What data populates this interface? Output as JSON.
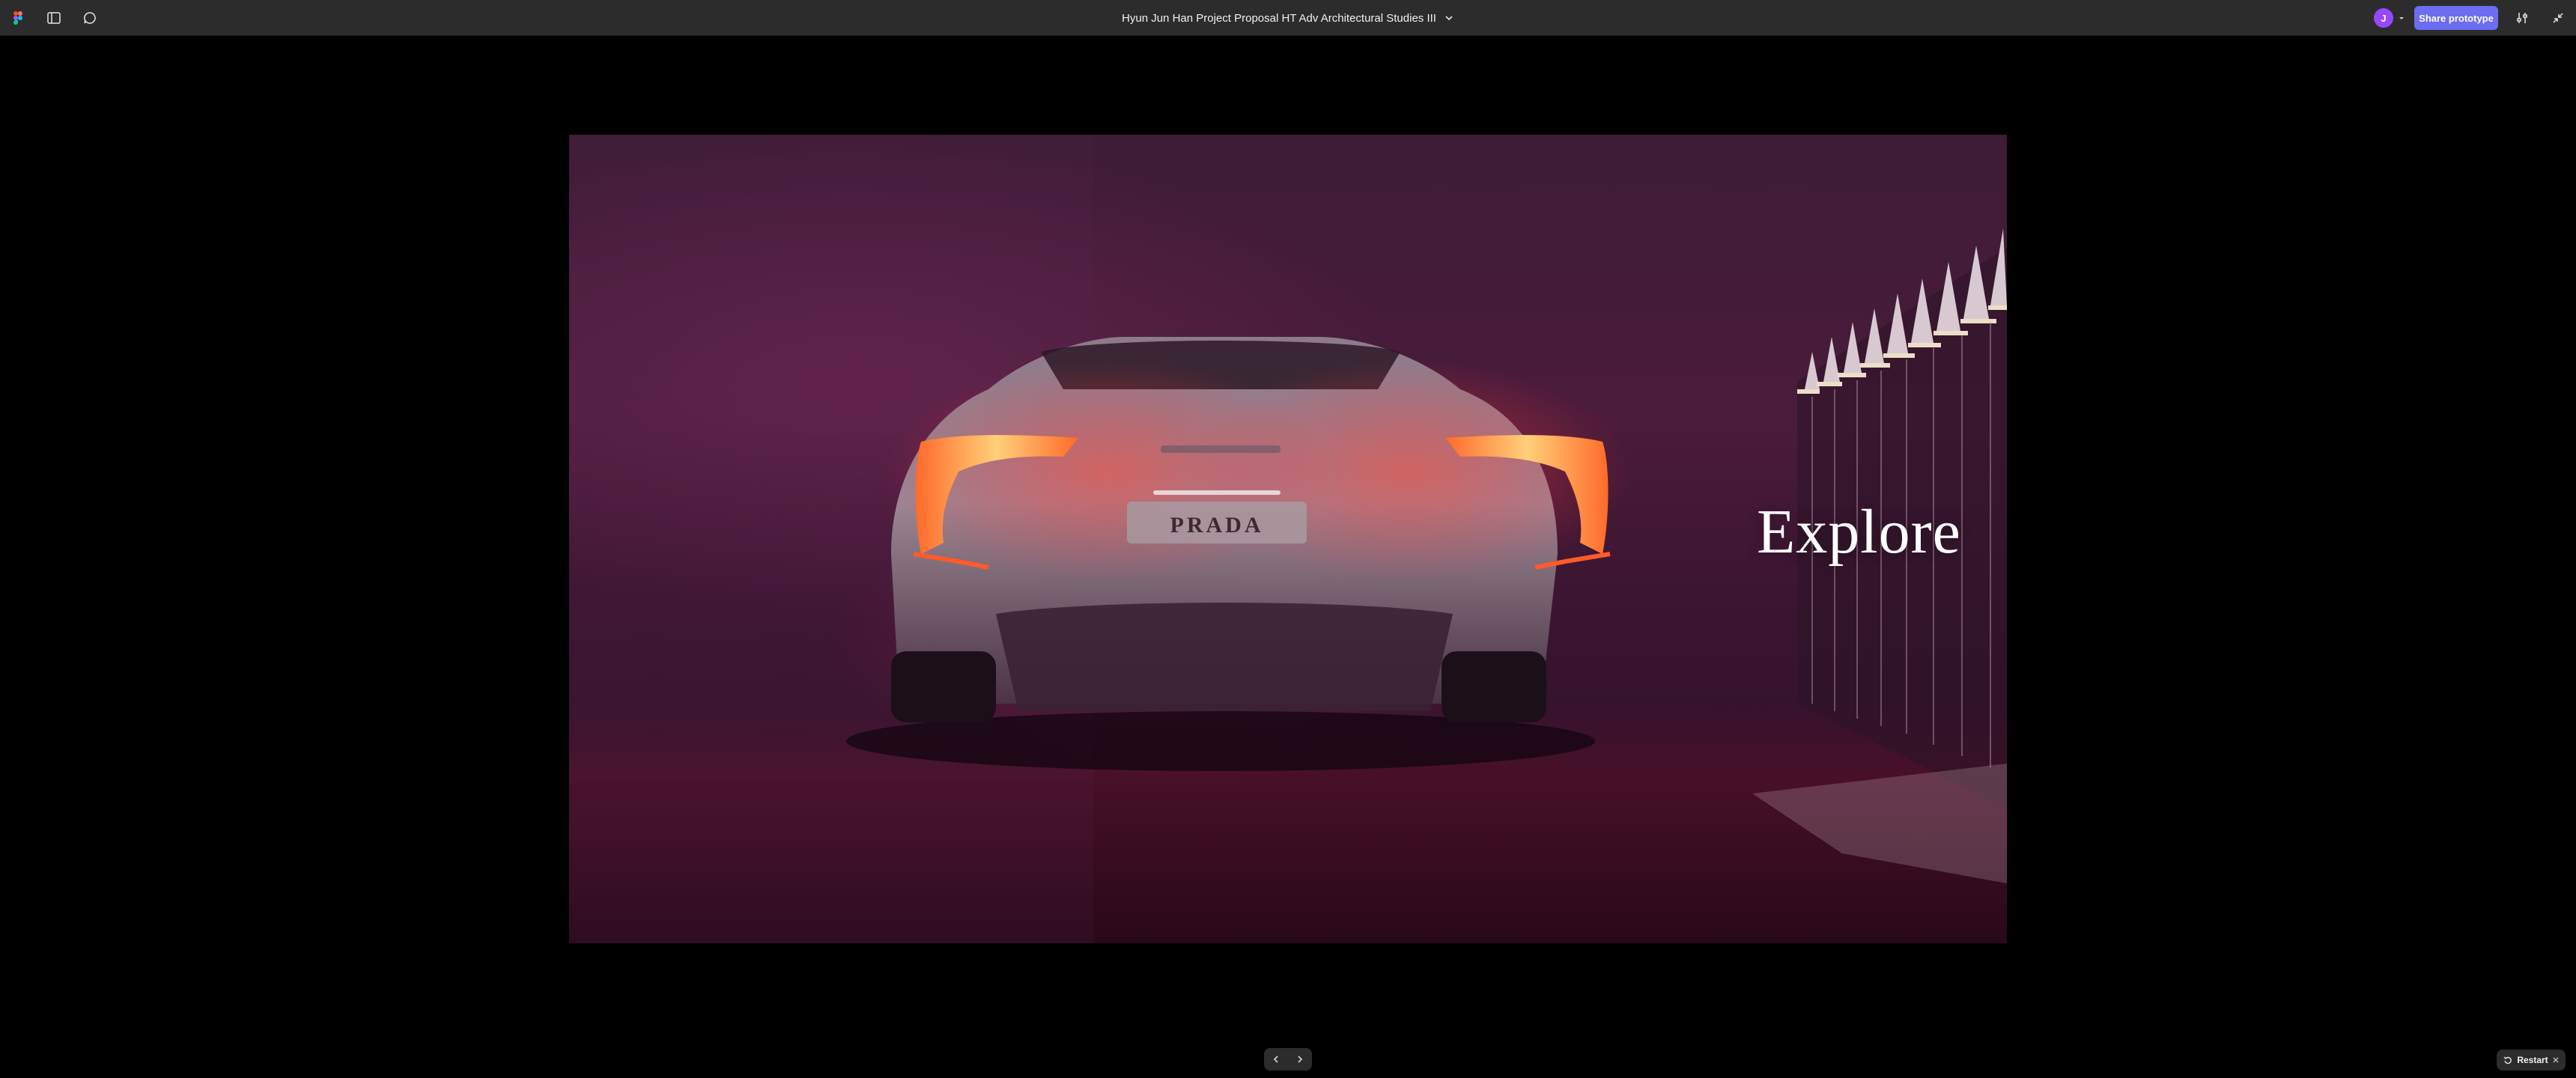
{
  "toolbar": {
    "title": "Hyun Jun Han Project Proposal HT Adv Architectural Studies III",
    "avatar_initial": "J",
    "share_label": "Share prototype",
    "icons": [
      "figma-logo-icon",
      "sidebar-toggle-icon",
      "comment-icon",
      "chevron-down-icon",
      "prototype-settings-icon",
      "collapse-icon"
    ]
  },
  "slide": {
    "heading": "Explore",
    "plate_text": "PRADA"
  },
  "controls": {
    "restart_label": "Restart",
    "icons": [
      "chevron-left-icon",
      "chevron-right-icon",
      "restart-icon",
      "close-icon"
    ]
  },
  "colors": {
    "toolbar_bg": "#2c2c2c",
    "share_button": "#6b6ef0",
    "avatar": "#9747ff",
    "canvas_bg": "#000000",
    "taillight": "#ff8a3d"
  }
}
